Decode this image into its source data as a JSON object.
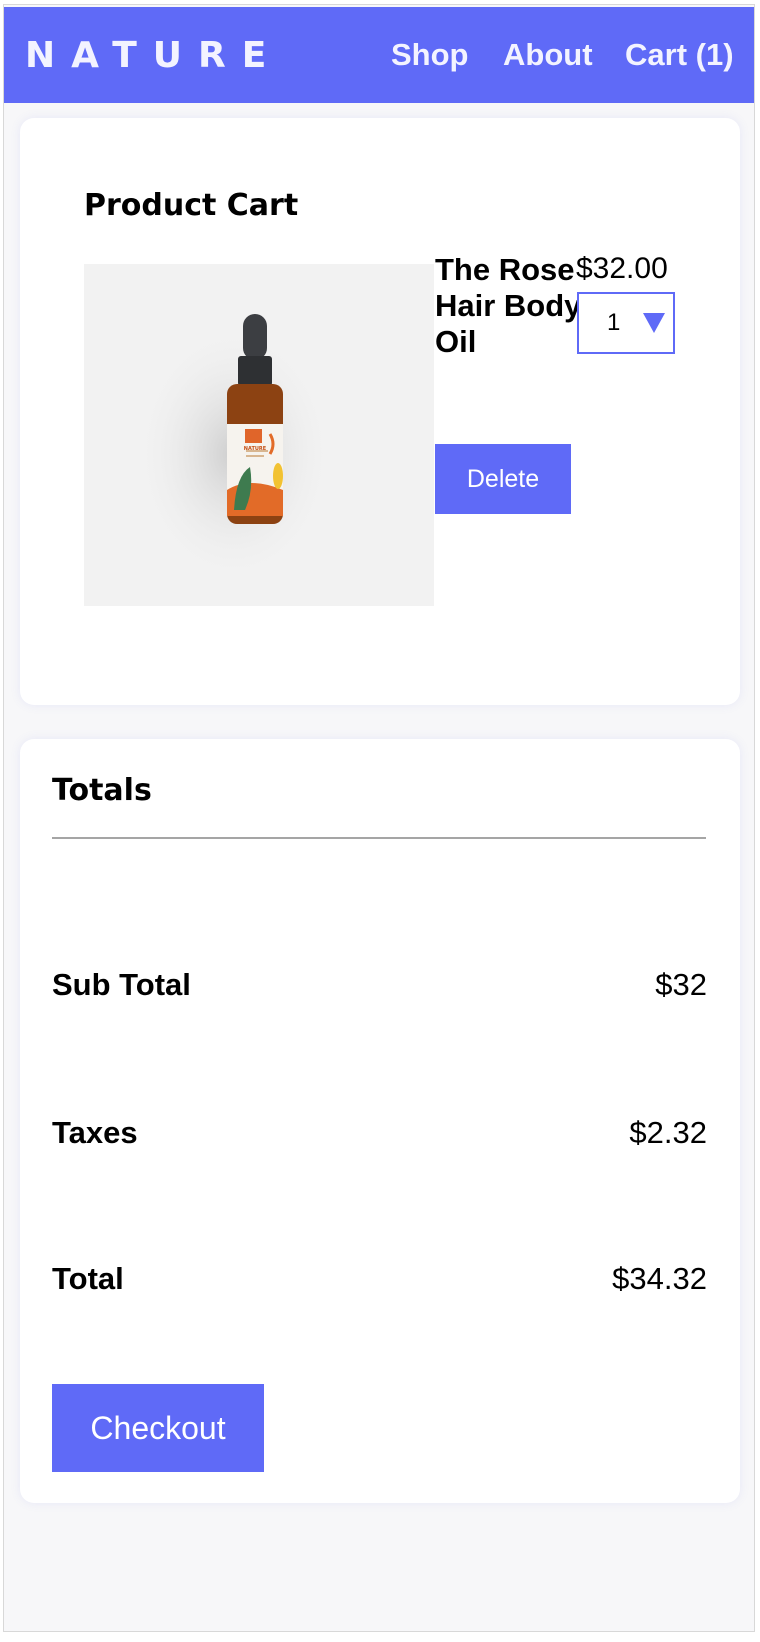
{
  "header": {
    "logo": "NATURE",
    "nav": {
      "shop": "Shop",
      "about": "About",
      "cart": "Cart (1)"
    }
  },
  "cart": {
    "title": "Product Cart",
    "item": {
      "name": "The Rose Hair Body Oil",
      "price": "$32.00",
      "quantity": "1",
      "delete_label": "Delete",
      "bottle_label_text": "NATURE"
    }
  },
  "totals": {
    "title": "Totals",
    "subtotal_label": "Sub Total",
    "subtotal_value": "$32",
    "taxes_label": "Taxes",
    "taxes_value": "$2.32",
    "total_label": "Total",
    "total_value": "$34.32",
    "checkout_label": "Checkout"
  },
  "colors": {
    "accent": "#5f6af7",
    "page_background": "#f7f7f9",
    "card_background": "#ffffff"
  }
}
